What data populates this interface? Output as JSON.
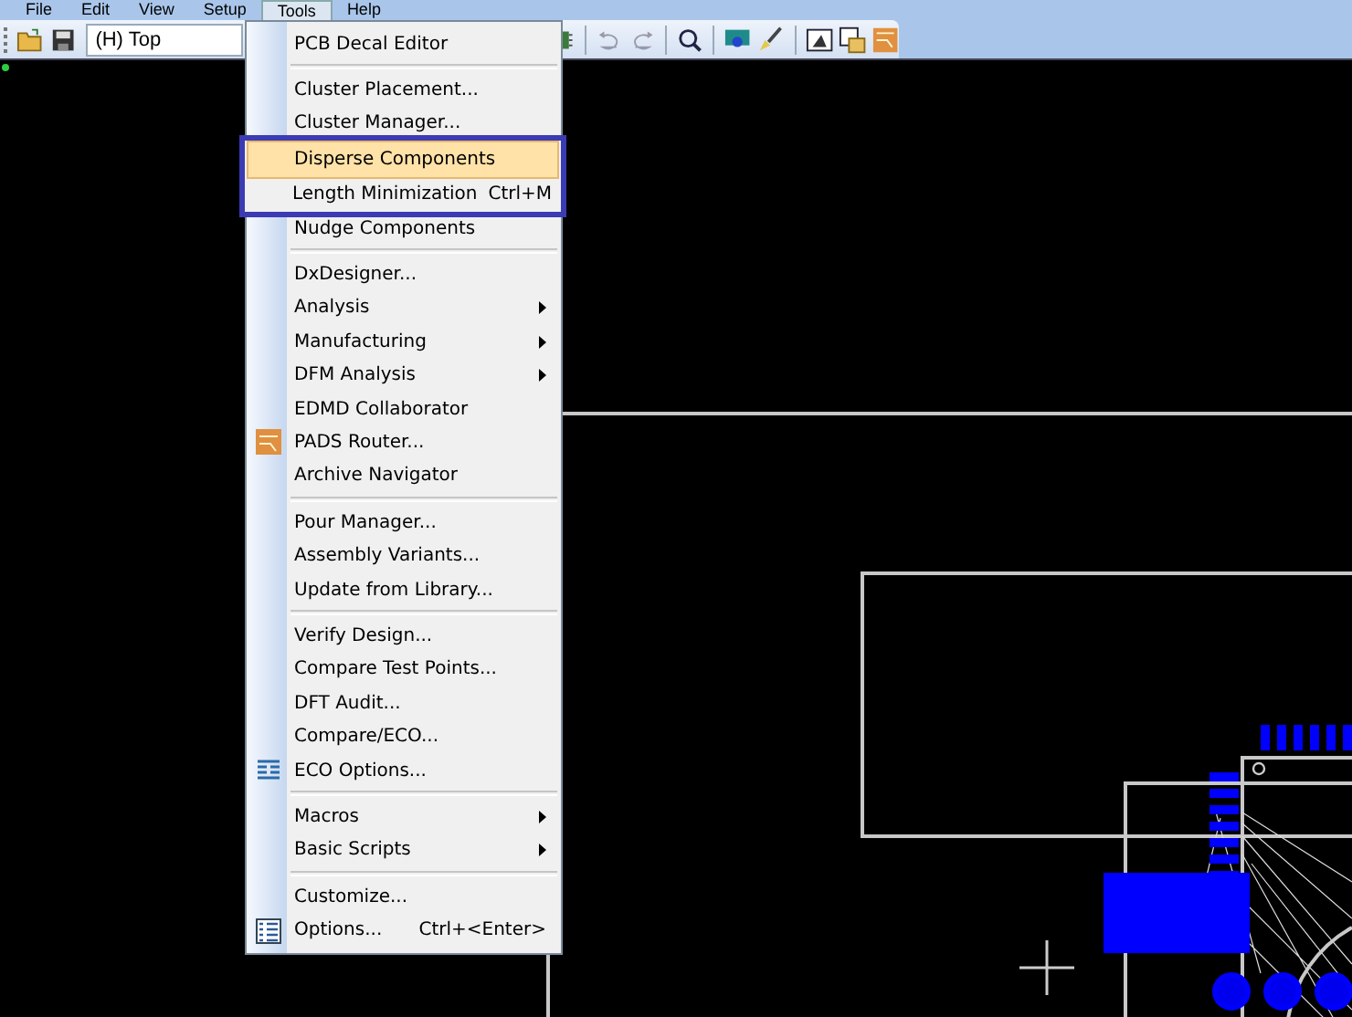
{
  "menu_bar": [
    {
      "label": "File",
      "selected": false
    },
    {
      "label": "Edit",
      "selected": false
    },
    {
      "label": "View",
      "selected": false
    },
    {
      "label": "Setup",
      "selected": false
    },
    {
      "label": "Tools",
      "selected": true
    },
    {
      "label": "Help",
      "selected": false
    }
  ],
  "toolbar": {
    "layer_select": {
      "value": "(H) Top"
    }
  },
  "tools_menu": {
    "groups": [
      [
        {
          "label": "PCB Decal Editor",
          "selected": false
        }
      ],
      [
        {
          "label": "Cluster Placement...",
          "selected": false
        },
        {
          "label": "Cluster Manager...",
          "selected": false
        },
        {
          "label": "Disperse Components",
          "selected": true
        },
        {
          "label": "Length Minimization",
          "shortcut": "Ctrl+M",
          "selected": false
        },
        {
          "label": "Nudge Components",
          "selected": false
        }
      ],
      [
        {
          "label": "DxDesigner...",
          "selected": false
        },
        {
          "label": "Analysis",
          "submenu": true,
          "selected": false
        },
        {
          "label": "Manufacturing",
          "submenu": true,
          "selected": false
        },
        {
          "label": "DFM Analysis",
          "submenu": true,
          "selected": false
        },
        {
          "label": "EDMD Collaborator",
          "selected": false
        },
        {
          "label": "PADS Router...",
          "selected": false
        },
        {
          "label": "Archive Navigator",
          "selected": false
        }
      ],
      [
        {
          "label": "Pour Manager...",
          "selected": false
        },
        {
          "label": "Assembly Variants...",
          "selected": false
        },
        {
          "label": "Update from Library...",
          "selected": false
        }
      ],
      [
        {
          "label": "Verify Design...",
          "selected": false
        },
        {
          "label": "Compare Test Points...",
          "selected": false
        },
        {
          "label": "DFT Audit...",
          "selected": false
        },
        {
          "label": "Compare/ECO...",
          "selected": false
        },
        {
          "label": "ECO Options...",
          "selected": false
        }
      ],
      [
        {
          "label": "Macros",
          "submenu": true,
          "selected": false
        },
        {
          "label": "Basic Scripts",
          "submenu": true,
          "selected": false
        }
      ],
      [
        {
          "label": "Customize...",
          "selected": false
        },
        {
          "label": "Options...",
          "shortcut": "Ctrl+<Enter>",
          "selected": false
        }
      ]
    ]
  }
}
